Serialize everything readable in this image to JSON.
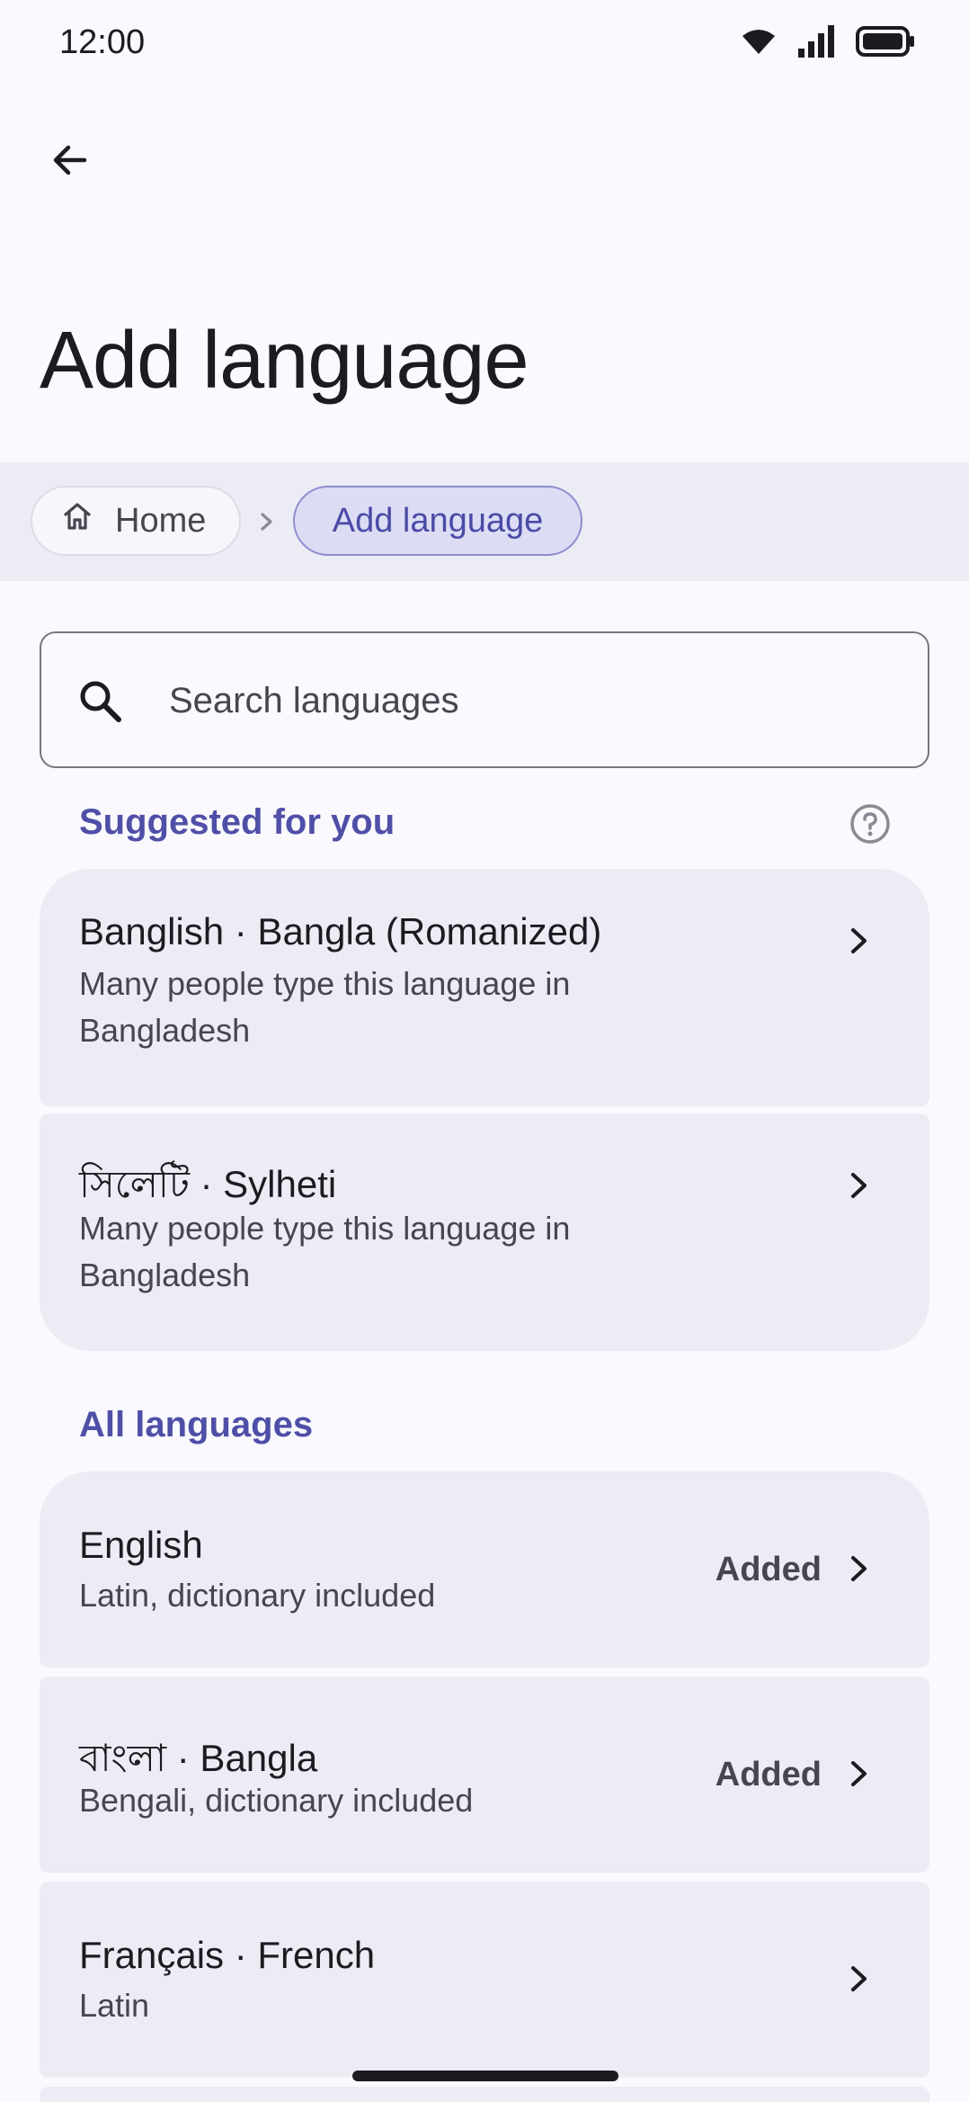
{
  "status_bar": {
    "time": "12:00",
    "icons": [
      "wifi-icon",
      "signal-icon",
      "battery-icon"
    ]
  },
  "app_bar": {
    "back_icon": "arrow-left-icon"
  },
  "page": {
    "title": "Add language"
  },
  "breadcrumb": {
    "home_label": "Home",
    "home_icon": "home-icon",
    "separator_icon": "chevron-right-icon",
    "current_label": "Add language"
  },
  "search": {
    "placeholder": "Search languages",
    "value": ""
  },
  "suggested": {
    "header": "Suggested for you",
    "help_icon": "help-circle-icon",
    "items": [
      {
        "title": "Banglish · Bangla (Romanized)",
        "subtitle": "Many people type this language in Bangladesh"
      },
      {
        "title": "সিলেটি · Sylheti",
        "subtitle": "Many people type this language in Bangladesh"
      }
    ]
  },
  "all_languages": {
    "header": "All languages",
    "items": [
      {
        "title": "English",
        "subtitle": "Latin, dictionary included",
        "status": "Added"
      },
      {
        "title": "বাংলা · Bangla",
        "subtitle": "Bengali, dictionary included",
        "status": "Added"
      },
      {
        "title": "Français · French",
        "subtitle": "Latin",
        "status": ""
      }
    ]
  },
  "colors": {
    "accent": "#4f4fa8",
    "background": "#f9f9fe",
    "surface": "#ececf4",
    "text": "#1b1b21"
  }
}
